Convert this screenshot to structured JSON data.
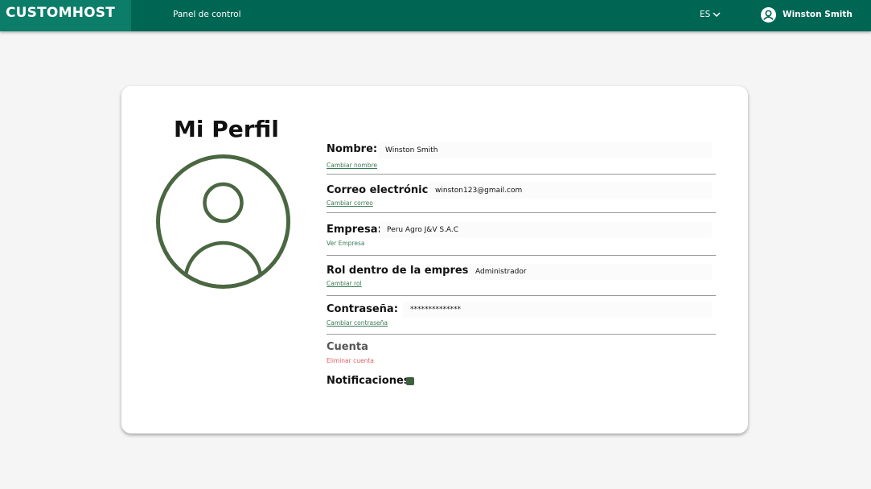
{
  "header": {
    "brand": "CUSTOMHOST",
    "nav_link": "Panel de control",
    "language": "ES",
    "user_name": "Winston Smith"
  },
  "profile": {
    "title": "Mi Perfil",
    "fields": [
      {
        "label": "Nombre:",
        "value": "Winston Smith",
        "link": "Cambiar nombre"
      },
      {
        "label": "Correo electrónico:",
        "value": "winston123@gmail.com",
        "link": "Cambiar correo"
      },
      {
        "label": "Empresa:",
        "value": "Peru Agro J&V S.A.C",
        "link": "Ver Empresa"
      },
      {
        "label": "Rol dentro de la empresa:",
        "value": "Administrador",
        "link": "Cambiar rol"
      },
      {
        "label": "Contraseña:",
        "value": "**************",
        "link": "Cambiar contraseña"
      }
    ],
    "account_label": "Cuenta",
    "delete_account": "Eliminar cuenta",
    "notifications_label": "Notificaciones",
    "notifications_enabled": true
  },
  "colors": {
    "header_bg": "#006654",
    "brand_bg": "#0c7d68",
    "accent_green": "#4a6741",
    "link_green": "#3b7a55",
    "danger": "#e06060"
  },
  "icons": {
    "language_dropdown": "chevron-down-icon",
    "user_avatar": "user-circle-icon",
    "profile_avatar": "user-circle-icon",
    "notifications_checkbox": "checkbox-checked-icon"
  }
}
